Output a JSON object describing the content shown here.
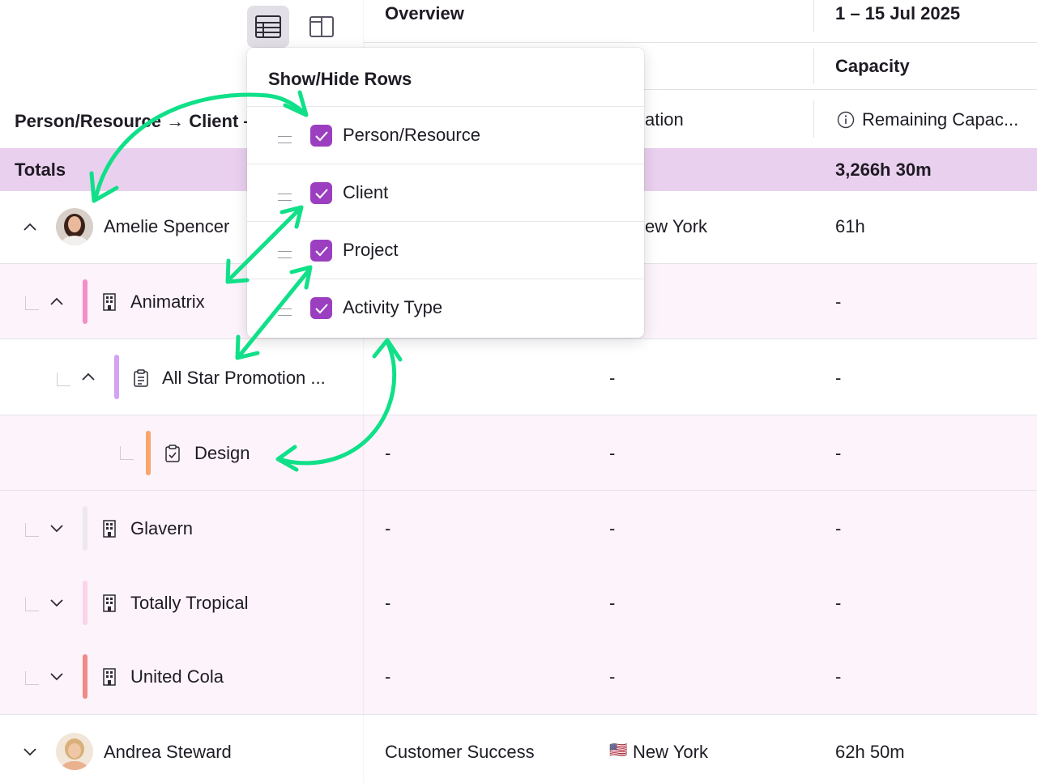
{
  "header": {
    "overview": "Overview",
    "date_range": "1 – 15 Jul 2025",
    "capacity": "Capacity",
    "group_by": "Person/Resource → Client –",
    "location_partial": "ation",
    "remaining_capacity": "Remaining Capac..."
  },
  "totals": {
    "label": "Totals",
    "capacity": "3,266h 30m"
  },
  "rows": [
    {
      "name": "Amelie Spencer",
      "location": "ew York",
      "capacity": "61h"
    },
    {
      "name": "Animatrix",
      "capacity": "-",
      "bar_color": "#f48ec7"
    },
    {
      "name": "All Star Promotion ...",
      "location": "-",
      "capacity": "-",
      "bar_color": "#d4a2f4"
    },
    {
      "name": "Design",
      "team": "-",
      "location": "-",
      "capacity": "-",
      "bar_color": "#f7a66e"
    },
    {
      "name": "Glavern",
      "team": "-",
      "location": "-",
      "capacity": "-",
      "bar_color": "#ebe9ee"
    },
    {
      "name": "Totally Tropical",
      "team": "-",
      "location": "-",
      "capacity": "-",
      "bar_color": "#fbd3ea"
    },
    {
      "name": "United Cola",
      "team": "-",
      "location": "-",
      "capacity": "-",
      "bar_color": "#f18a86"
    },
    {
      "name": "Andrea Steward",
      "team": "Customer Success",
      "location": "New York",
      "flag": "🇺🇸",
      "capacity": "62h 50m"
    }
  ],
  "menu": {
    "title": "Show/Hide Rows",
    "items": [
      {
        "label": "Person/Resource",
        "checked": true
      },
      {
        "label": "Client",
        "checked": true
      },
      {
        "label": "Project",
        "checked": true
      },
      {
        "label": "Activity Type",
        "checked": true
      }
    ]
  },
  "colors": {
    "accent": "#9b3fc0",
    "totals_bg": "#ead0ef",
    "arrow": "#10e088"
  }
}
